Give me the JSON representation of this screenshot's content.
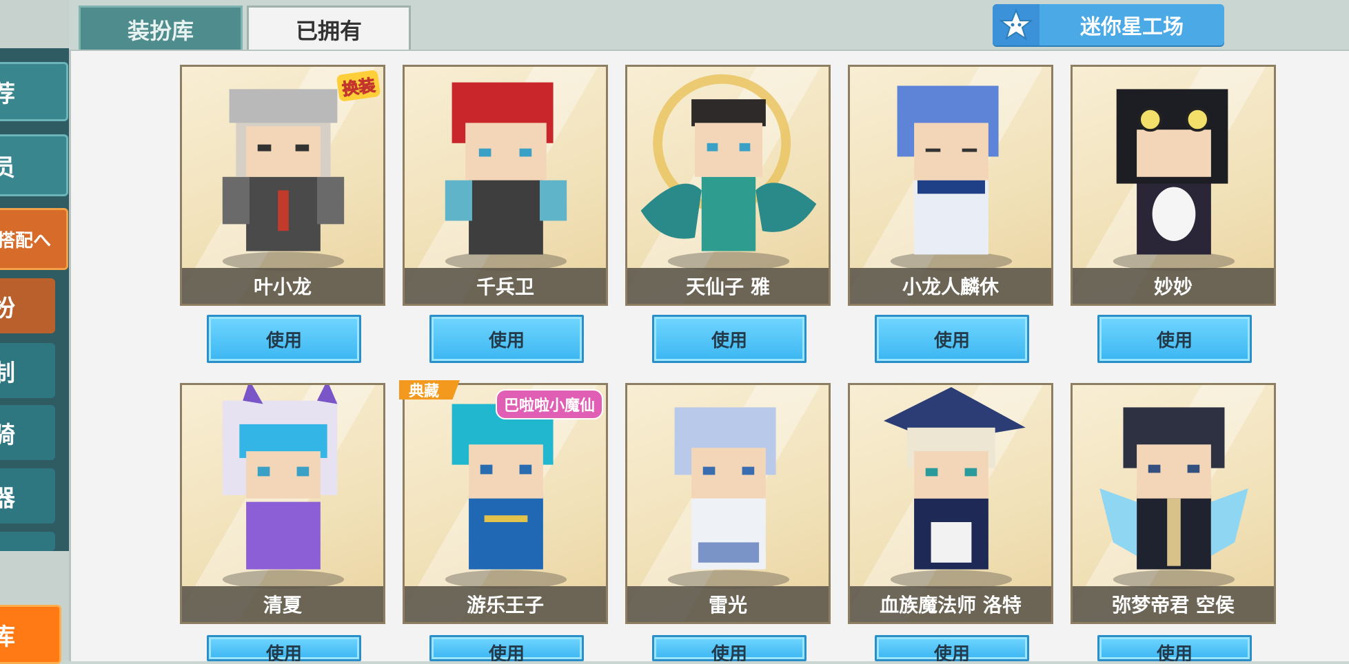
{
  "tabs": {
    "wardrobe": "装扮库",
    "owned": "已拥有"
  },
  "workshop": {
    "label": "迷你星工场",
    "icon": "star-icon"
  },
  "sidebar": {
    "items": [
      {
        "label": "荐"
      },
      {
        "label": "员"
      },
      {
        "label": "搭配へ"
      },
      {
        "label": "扮"
      },
      {
        "label": "制"
      },
      {
        "label": "骑"
      },
      {
        "label": "器"
      }
    ],
    "bottom": "库"
  },
  "cards": [
    {
      "name": "叶小龙",
      "badge": "换装",
      "use_label": "使用"
    },
    {
      "name": "千兵卫",
      "use_label": "使用"
    },
    {
      "name": "天仙子 雅",
      "use_label": "使用"
    },
    {
      "name": "小龙人麟休",
      "use_label": "使用"
    },
    {
      "name": "妙妙",
      "use_label": "使用"
    },
    {
      "name": "清夏",
      "use_label": "使用"
    },
    {
      "name": "游乐王子",
      "tag": "典藏",
      "badge": "巴啦啦小魔仙",
      "use_label": "使用"
    },
    {
      "name": "雷光",
      "use_label": "使用"
    },
    {
      "name": "血族魔法师 洛特",
      "use_label": "使用"
    },
    {
      "name": "弥梦帝君 空侯",
      "use_label": "使用"
    }
  ],
  "colors": {
    "accent_orange": "#d76b2a",
    "button_blue": "#3bb6f1",
    "sidebar_teal": "#3a868f"
  }
}
